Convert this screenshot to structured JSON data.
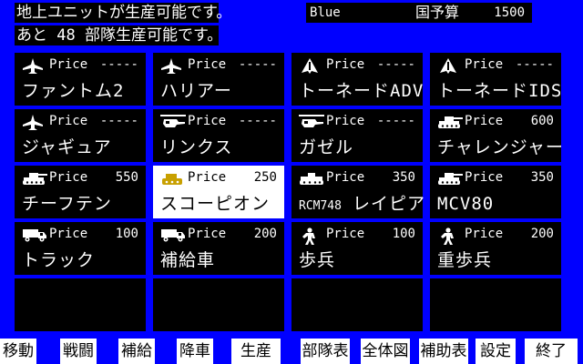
{
  "status": {
    "line1": "地上ユニットが生産可能です。",
    "line2": "あと 48 部隊生産可能です。"
  },
  "side": {
    "name": "Blue",
    "budget_label": "国予算",
    "budget_value": "1500"
  },
  "colors": {
    "background": "#0000ff",
    "panel": "#000000",
    "text": "#ffffff",
    "selected_bg": "#ffffff",
    "selected_text": "#000000"
  },
  "units": [
    {
      "icon": "jet-fighter-icon",
      "price_label": "Price",
      "price": "-----",
      "name": "ファントム2",
      "prefix": ""
    },
    {
      "icon": "jet-fighter-icon",
      "price_label": "Price",
      "price": "-----",
      "name": "ハリアー",
      "prefix": ""
    },
    {
      "icon": "delta-jet-icon",
      "price_label": "Price",
      "price": "-----",
      "name": "トーネードADV",
      "prefix": ""
    },
    {
      "icon": "delta-jet-icon",
      "price_label": "Price",
      "price": "-----",
      "name": "トーネードIDS",
      "prefix": ""
    },
    {
      "icon": "jet-fighter-icon",
      "price_label": "Price",
      "price": "-----",
      "name": "ジャギュア",
      "prefix": ""
    },
    {
      "icon": "helicopter-icon",
      "price_label": "Price",
      "price": "-----",
      "name": "リンクス",
      "prefix": ""
    },
    {
      "icon": "helicopter-icon",
      "price_label": "Price",
      "price": "-----",
      "name": "ガゼル",
      "prefix": ""
    },
    {
      "icon": "tank-icon",
      "price_label": "Price",
      "price": "600",
      "name": "チャレンジャー",
      "prefix": ""
    },
    {
      "icon": "tank-icon",
      "price_label": "Price",
      "price": "550",
      "name": "チーフテン",
      "prefix": ""
    },
    {
      "icon": "light-tank-icon",
      "price_label": "Price",
      "price": "250",
      "name": "スコーピオン",
      "prefix": "",
      "selected": true
    },
    {
      "icon": "apc-icon",
      "price_label": "Price",
      "price": "350",
      "name": "レイピア",
      "prefix": "RCM748"
    },
    {
      "icon": "tank-icon",
      "price_label": "Price",
      "price": "350",
      "name": "MCV80",
      "prefix": ""
    },
    {
      "icon": "truck-icon",
      "price_label": "Price",
      "price": "100",
      "name": "トラック",
      "prefix": ""
    },
    {
      "icon": "truck-icon",
      "price_label": "Price",
      "price": "200",
      "name": "補給車",
      "prefix": ""
    },
    {
      "icon": "infantry-icon",
      "price_label": "Price",
      "price": "100",
      "name": "歩兵",
      "prefix": ""
    },
    {
      "icon": "infantry-icon",
      "price_label": "Price",
      "price": "200",
      "name": "重歩兵",
      "prefix": ""
    }
  ],
  "menu": [
    "移動",
    "戦闘",
    "補給",
    "降車",
    "生産",
    "部隊表",
    "全体図",
    "補助表",
    "設定",
    "終了"
  ]
}
